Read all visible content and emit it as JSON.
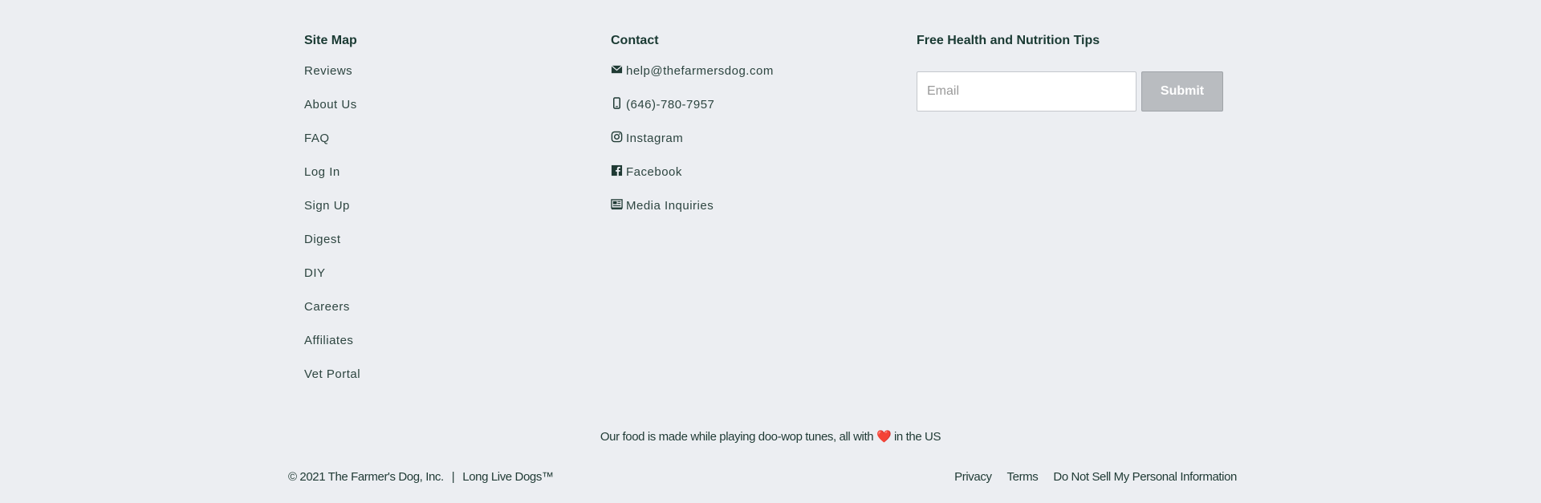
{
  "site_map": {
    "heading": "Site Map",
    "items": [
      "Reviews",
      "About Us",
      "FAQ",
      "Log In",
      "Sign Up",
      "Digest",
      "DIY",
      "Careers",
      "Affiliates",
      "Vet Portal"
    ]
  },
  "contact": {
    "heading": "Contact",
    "items": [
      {
        "icon": "mail-icon",
        "label": "help@thefarmersdog.com"
      },
      {
        "icon": "phone-icon",
        "label": "(646)-780-7957"
      },
      {
        "icon": "instagram-icon",
        "label": "Instagram"
      },
      {
        "icon": "facebook-icon",
        "label": "Facebook"
      },
      {
        "icon": "media-icon",
        "label": "Media Inquiries"
      }
    ]
  },
  "newsletter": {
    "heading": "Free Health and Nutrition Tips",
    "email_placeholder": "Email",
    "submit_label": "Submit"
  },
  "tagline": {
    "before": "Our food is made while playing doo-wop tunes, all with ",
    "heart": "❤️",
    "after": " in the US"
  },
  "legal": {
    "copyright": "© 2021 The Farmer's Dog, Inc.",
    "separator": "|",
    "slogan": "Long Live Dogs™",
    "links": [
      "Privacy",
      "Terms",
      "Do Not Sell My Personal Information"
    ]
  },
  "colors": {
    "background": "#eceef2",
    "text": "#1f3a34",
    "submit_bg": "#b9bcc0"
  }
}
